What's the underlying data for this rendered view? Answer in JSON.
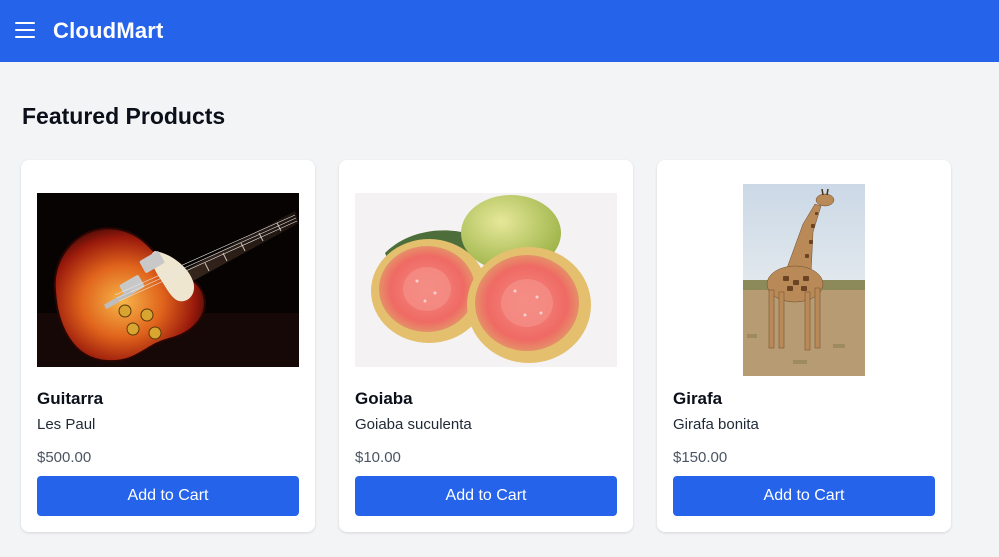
{
  "header": {
    "brand": "CloudMart",
    "menu_icon": "hamburger-menu-icon",
    "background": "#2563eb"
  },
  "main": {
    "section_title": "Featured Products",
    "products": [
      {
        "name": "Guitarra",
        "description": "Les Paul",
        "price": "$500.00",
        "button_label": "Add to Cart",
        "image": "electric-guitar-image"
      },
      {
        "name": "Goiaba",
        "description": "Goiaba suculenta",
        "price": "$10.00",
        "button_label": "Add to Cart",
        "image": "guava-fruit-image"
      },
      {
        "name": "Girafa",
        "description": "Girafa bonita",
        "price": "$150.00",
        "button_label": "Add to Cart",
        "image": "giraffe-image"
      }
    ]
  },
  "colors": {
    "accent": "#2563eb",
    "page_background": "#f3f4f6",
    "card_background": "#ffffff"
  }
}
